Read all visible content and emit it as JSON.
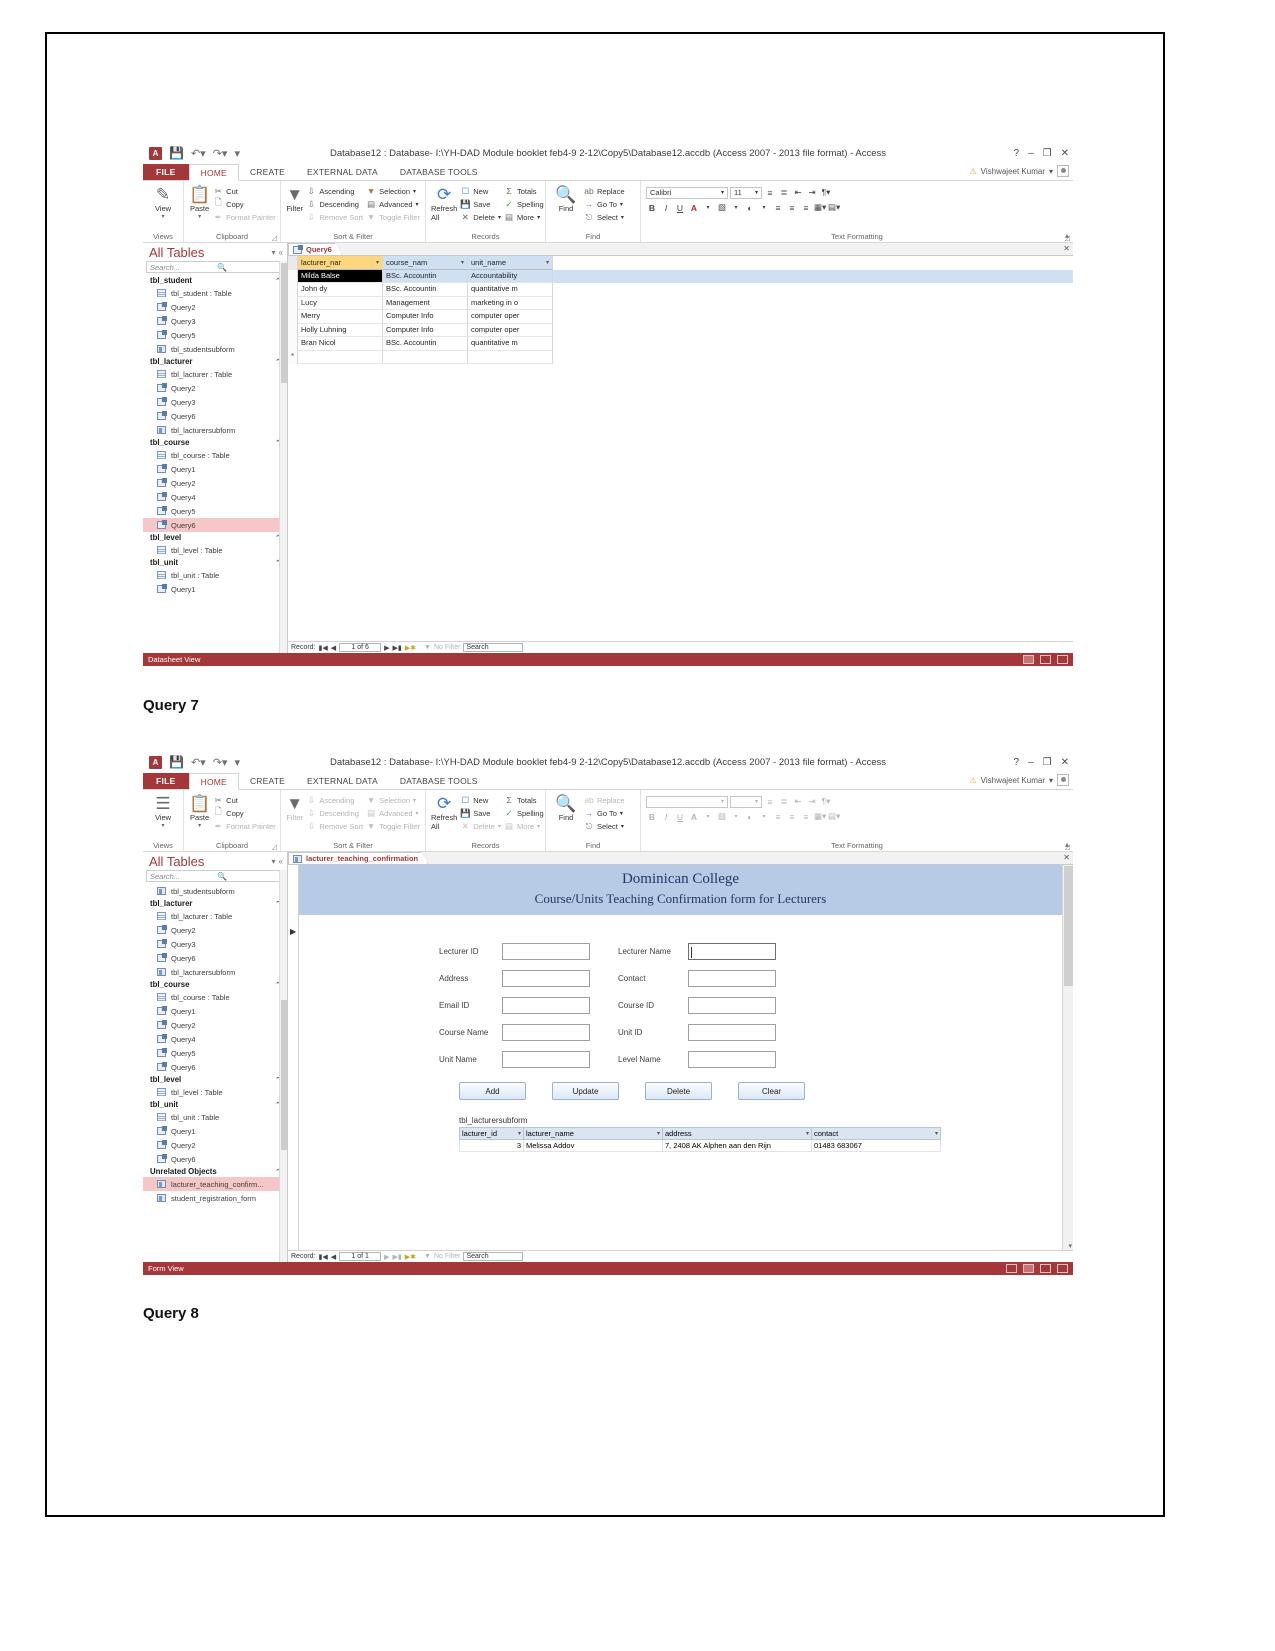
{
  "document": {
    "caption_1": "Query 7",
    "caption_2": "Query 8"
  },
  "window": {
    "title": "Database12 : Database- I:\\YH-DAD Module booklet feb4-9 2-12\\Copy5\\Database12.accdb (Access 2007 - 2013 file format) - Access",
    "user": "Vishwajeet Kumar",
    "app_badge": "A",
    "qat": {
      "save": "save-icon",
      "undo": "undo-icon",
      "redo": "redo-icon",
      "customize": "customize-icon"
    },
    "controls": {
      "help": "?",
      "minimize": "–",
      "restore": "❐",
      "close": "✕"
    }
  },
  "ribbon": {
    "tabs": [
      "FILE",
      "HOME",
      "CREATE",
      "EXTERNAL DATA",
      "DATABASE TOOLS"
    ],
    "active_tab": "HOME",
    "groups": [
      {
        "label": "Views",
        "buttons": [
          {
            "label": "View",
            "icon": "view-icon"
          }
        ]
      },
      {
        "label": "Clipboard",
        "buttons": [
          {
            "label": "Paste",
            "icon": "paste-icon"
          },
          {
            "label": "Cut",
            "icon": "cut-icon"
          },
          {
            "label": "Copy",
            "icon": "copy-icon"
          },
          {
            "label": "Format Painter",
            "icon": "format-painter-icon"
          }
        ]
      },
      {
        "label": "Sort & Filter",
        "buttons": [
          {
            "label": "Filter",
            "icon": "filter-icon"
          },
          {
            "label": "Ascending",
            "icon": "sort-asc-icon"
          },
          {
            "label": "Descending",
            "icon": "sort-desc-icon"
          },
          {
            "label": "Remove Sort",
            "icon": "remove-sort-icon"
          },
          {
            "label": "Selection",
            "icon": "selection-icon"
          },
          {
            "label": "Advanced",
            "icon": "advanced-icon"
          },
          {
            "label": "Toggle Filter",
            "icon": "toggle-filter-icon"
          }
        ]
      },
      {
        "label": "Records",
        "buttons": [
          {
            "label": "Refresh All",
            "icon": "refresh-icon"
          },
          {
            "label": "New",
            "icon": "new-record-icon"
          },
          {
            "label": "Save",
            "icon": "save-record-icon"
          },
          {
            "label": "Delete",
            "icon": "delete-record-icon"
          },
          {
            "label": "Totals",
            "icon": "totals-icon"
          },
          {
            "label": "Spelling",
            "icon": "spelling-icon"
          },
          {
            "label": "More",
            "icon": "more-icon"
          }
        ]
      },
      {
        "label": "Find",
        "buttons": [
          {
            "label": "Find",
            "icon": "find-icon"
          },
          {
            "label": "Replace",
            "icon": "replace-icon"
          },
          {
            "label": "Go To",
            "icon": "goto-icon"
          },
          {
            "label": "Select",
            "icon": "select-icon"
          }
        ]
      },
      {
        "label": "Text Formatting",
        "font_name": "Calibri",
        "font_size": "11",
        "buttons": [
          "B",
          "I",
          "U",
          "A",
          "highlight",
          "fill",
          "align-left",
          "align-center",
          "align-right",
          "gridlines",
          "alt-fill"
        ]
      }
    ]
  },
  "navpane": {
    "title": "All Tables",
    "search_placeholder": "Search...",
    "groups": [
      {
        "name": "tbl_student",
        "items": [
          {
            "label": "tbl_student : Table",
            "type": "table"
          },
          {
            "label": "Query2",
            "type": "query"
          },
          {
            "label": "Query3",
            "type": "query"
          },
          {
            "label": "Query5",
            "type": "query"
          },
          {
            "label": "tbl_studentsubform",
            "type": "form"
          }
        ]
      },
      {
        "name": "tbl_lacturer",
        "items": [
          {
            "label": "tbl_lacturer : Table",
            "type": "table"
          },
          {
            "label": "Query2",
            "type": "query"
          },
          {
            "label": "Query3",
            "type": "query"
          },
          {
            "label": "Query6",
            "type": "query"
          },
          {
            "label": "tbl_lacturersubform",
            "type": "form"
          }
        ]
      },
      {
        "name": "tbl_course",
        "items": [
          {
            "label": "tbl_course : Table",
            "type": "table"
          },
          {
            "label": "Query1",
            "type": "query"
          },
          {
            "label": "Query2",
            "type": "query"
          },
          {
            "label": "Query4",
            "type": "query"
          },
          {
            "label": "Query5",
            "type": "query"
          },
          {
            "label": "Query6",
            "type": "query",
            "selected": true
          }
        ]
      },
      {
        "name": "tbl_level",
        "items": [
          {
            "label": "tbl_level : Table",
            "type": "table"
          }
        ]
      },
      {
        "name": "tbl_unit",
        "items": [
          {
            "label": "tbl_unit : Table",
            "type": "table"
          },
          {
            "label": "Query1",
            "type": "query"
          }
        ]
      }
    ]
  },
  "navpane2": {
    "title": "All Tables",
    "search_placeholder": "Search...",
    "groups": [
      {
        "name": "",
        "items": [
          {
            "label": "tbl_studentsubform",
            "type": "form"
          }
        ]
      },
      {
        "name": "tbl_lacturer",
        "items": [
          {
            "label": "tbl_lacturer : Table",
            "type": "table"
          },
          {
            "label": "Query2",
            "type": "query"
          },
          {
            "label": "Query3",
            "type": "query"
          },
          {
            "label": "Query6",
            "type": "query"
          },
          {
            "label": "tbl_lacturersubform",
            "type": "form"
          }
        ]
      },
      {
        "name": "tbl_course",
        "items": [
          {
            "label": "tbl_course : Table",
            "type": "table"
          },
          {
            "label": "Query1",
            "type": "query"
          },
          {
            "label": "Query2",
            "type": "query"
          },
          {
            "label": "Query4",
            "type": "query"
          },
          {
            "label": "Query5",
            "type": "query"
          },
          {
            "label": "Query6",
            "type": "query"
          }
        ]
      },
      {
        "name": "tbl_level",
        "items": [
          {
            "label": "tbl_level : Table",
            "type": "table"
          }
        ]
      },
      {
        "name": "tbl_unit",
        "items": [
          {
            "label": "tbl_unit : Table",
            "type": "table"
          },
          {
            "label": "Query1",
            "type": "query"
          },
          {
            "label": "Query2",
            "type": "query"
          },
          {
            "label": "Query6",
            "type": "query"
          }
        ]
      },
      {
        "name": "Unrelated Objects",
        "items": [
          {
            "label": "lacturer_teaching_confirm...",
            "type": "form",
            "selected": true
          },
          {
            "label": "student_registration_form",
            "type": "form"
          }
        ]
      }
    ]
  },
  "query_window": {
    "doc_tab": "Query6",
    "columns": [
      "lacturer_nar",
      "course_nam",
      "unit_name"
    ],
    "rows": [
      [
        "Milda Balse",
        "BSc. Accountin",
        "Accountability"
      ],
      [
        "John dy",
        "BSc. Accountin",
        "quantitative m"
      ],
      [
        "Lucy",
        "Management",
        "marketing in o"
      ],
      [
        "Merry",
        "Computer Info",
        "computer oper"
      ],
      [
        "Holly Luhning",
        "Computer Info",
        "computer oper"
      ],
      [
        "Bran Nicol",
        "BSc. Accountin",
        "quantitative m"
      ]
    ],
    "navigator": {
      "label": "Record:",
      "position": "1 of 6",
      "filter": "No Filter",
      "search_placeholder": "Search"
    },
    "status": "Datasheet View"
  },
  "form_window": {
    "doc_tab": "lacturer_teaching_confirmation",
    "header_line1": "Dominican College",
    "header_line2": "Course/Units Teaching Confirmation form for Lecturers",
    "fields_left": [
      {
        "label": "Lecturer ID",
        "value": ""
      },
      {
        "label": "Address",
        "value": ""
      },
      {
        "label": "Email ID",
        "value": ""
      },
      {
        "label": "Course Name",
        "value": ""
      },
      {
        "label": "Unit Name",
        "value": ""
      }
    ],
    "fields_right": [
      {
        "label": "Lecturer Name",
        "value": "",
        "focused": true
      },
      {
        "label": "Contact",
        "value": ""
      },
      {
        "label": "Course ID",
        "value": ""
      },
      {
        "label": "Unit ID",
        "value": ""
      },
      {
        "label": "Level Name",
        "value": ""
      }
    ],
    "buttons": [
      "Add",
      "Update",
      "Delete",
      "Clear"
    ],
    "subform": {
      "title": "tbl_lacturersubform",
      "columns": [
        "lacturer_id",
        "lacturer_name",
        "address",
        "contact"
      ],
      "rows": [
        [
          "3",
          "Melissa Addov",
          "7, 2408 AK Alphen aan den Rijn",
          "01483 683067"
        ]
      ]
    },
    "navigator": {
      "label": "Record:",
      "position": "1 of 1",
      "filter": "No Filter",
      "search_placeholder": "Search"
    },
    "status": "Form View"
  }
}
